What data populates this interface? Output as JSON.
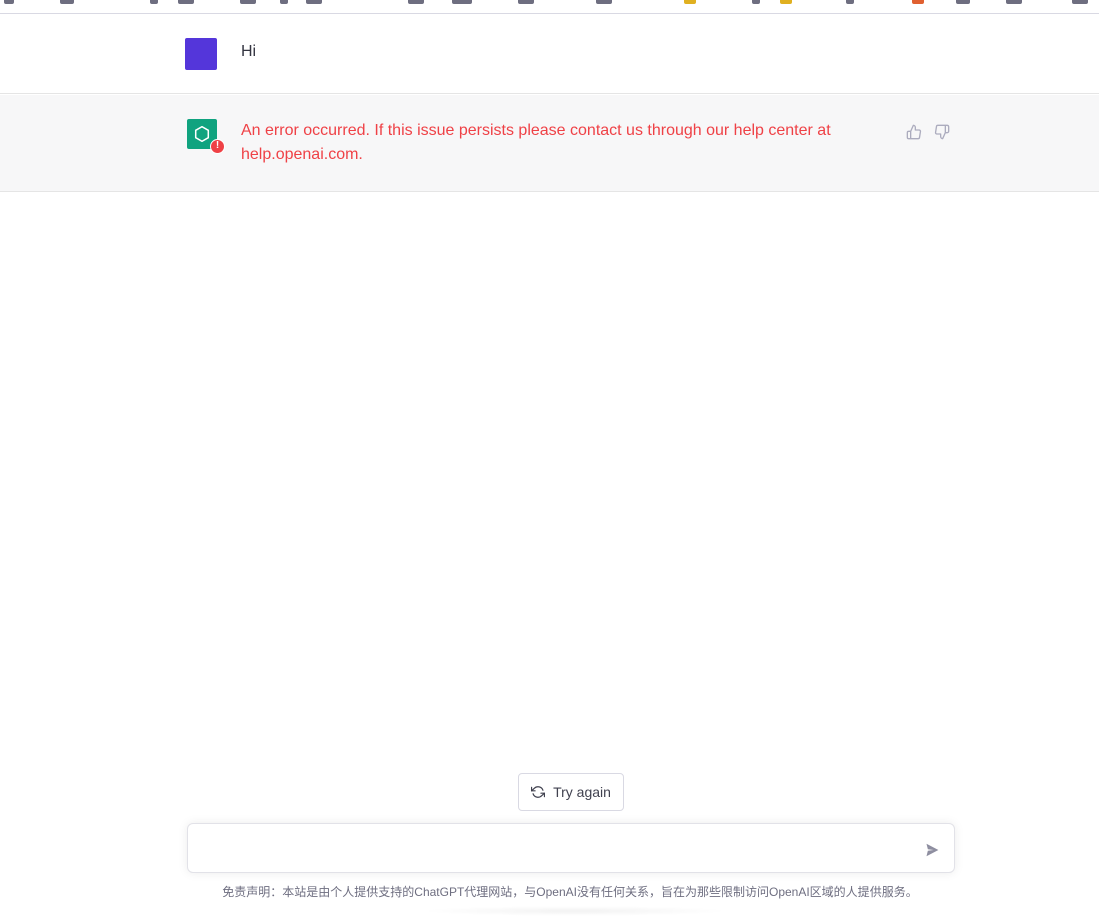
{
  "conversation": {
    "user_message": "Hi",
    "assistant_error": "An error occurred. If this issue persists please contact us through our help center at help.openai.com.",
    "error_badge": "!"
  },
  "actions": {
    "try_again_label": "Try again"
  },
  "composer": {
    "value": "",
    "placeholder": ""
  },
  "footer": {
    "disclaimer": "免责声明：本站是由个人提供支持的ChatGPT代理网站，与OpenAI没有任何关系，旨在为那些限制访问OpenAI区域的人提供服务。"
  },
  "colors": {
    "user_avatar": "#5436da",
    "assistant_avatar": "#10a37f",
    "error_text": "#ef4146",
    "assistant_row_bg": "#f7f7f8"
  },
  "icons": {
    "assistant_avatar": "openai-logo-icon",
    "error_badge": "error-icon",
    "thumbs_up": "thumbs-up-icon",
    "thumbs_down": "thumbs-down-icon",
    "try_again": "refresh-icon",
    "send": "send-icon"
  }
}
